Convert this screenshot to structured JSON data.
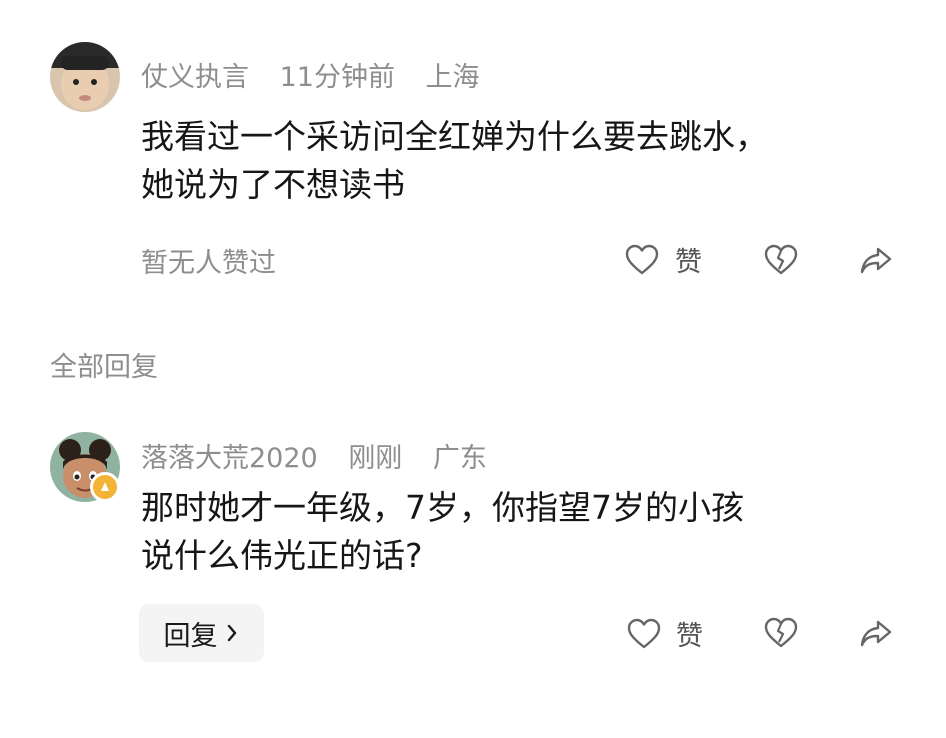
{
  "comment": {
    "username": "仗义执言",
    "time": "11分钟前",
    "location": "上海",
    "text_line1": "我看过一个采访问全红婵为什么要去跳水，",
    "text_line2": "她说为了不想读书",
    "likes_text": "暂无人赞过",
    "like_label": "赞"
  },
  "section": {
    "all_replies": "全部回复"
  },
  "reply": {
    "username": "落落大荒2020",
    "time": "刚刚",
    "location": "广东",
    "text_line1": "那时她才一年级，7岁，你指望7岁的小孩",
    "text_line2": "说什么伟光正的话?",
    "reply_label": "回复",
    "like_label": "赞"
  },
  "icons": {
    "like": "heart-outline-icon",
    "dislike": "broken-heart-icon",
    "share": "share-arrow-icon",
    "chevron": "chevron-right-icon"
  }
}
